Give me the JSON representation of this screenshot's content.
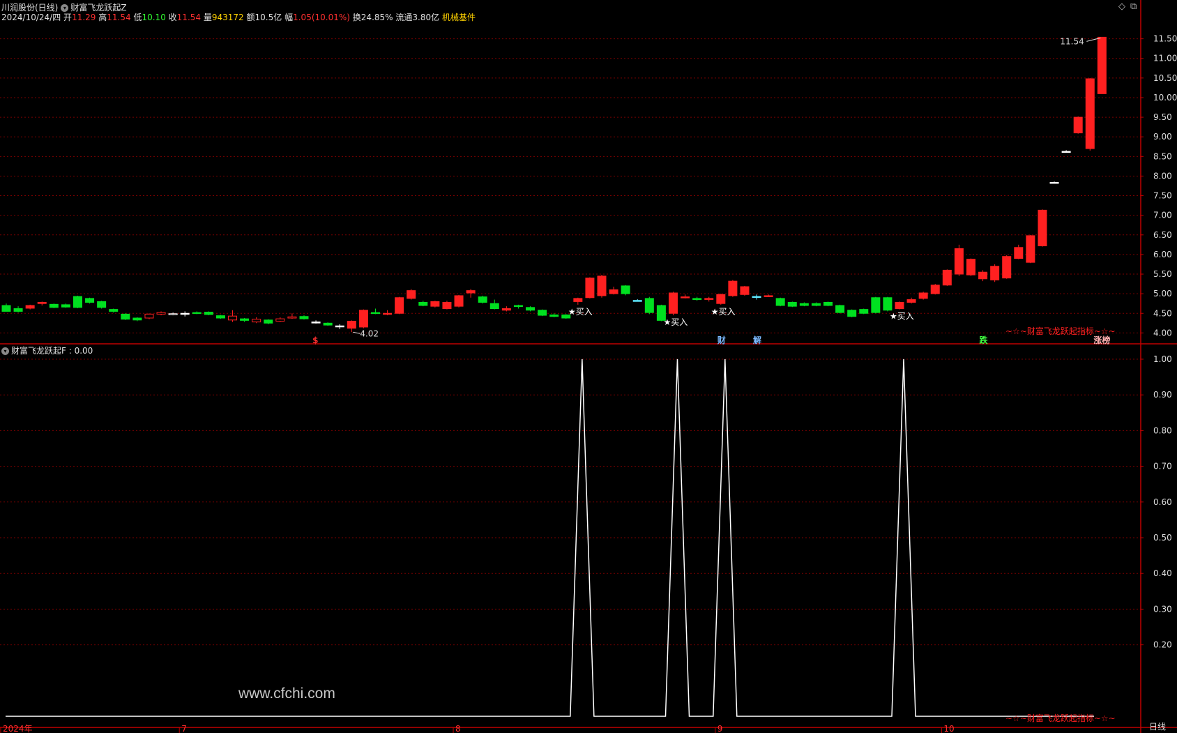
{
  "header": {
    "stock_name": "川润股份(日线)",
    "indicator_main": "财富飞龙跃起Z",
    "date": "2024/10/24/四",
    "open_label": "开",
    "open": "11.29",
    "high_label": "高",
    "high": "11.54",
    "low_label": "低",
    "low": "10.10",
    "close_label": "收",
    "close": "11.54",
    "volume_label": "量",
    "volume": "943172",
    "amount_label": "额",
    "amount": "10.5亿",
    "change_label": "幅",
    "change": "1.05(10.01%)",
    "turnover_label": "换",
    "turnover": "24.85%",
    "float_label": "流通",
    "float_cap": "3.80亿",
    "sector": "机械基件"
  },
  "sub_header": {
    "indicator": "财富飞龙跃起F",
    "value": ": 0.00"
  },
  "corner_buttons": [
    "◇",
    "⧉"
  ],
  "main_price_axis": [
    "11.50",
    "11.00",
    "10.50",
    "10.00",
    "9.50",
    "9.00",
    "8.50",
    "8.00",
    "7.50",
    "7.00",
    "6.50",
    "6.00",
    "5.50",
    "5.00",
    "4.50",
    "4.00"
  ],
  "sub_axis": [
    "1.00",
    "0.90",
    "0.80",
    "0.70",
    "0.60",
    "0.50",
    "0.40",
    "0.30",
    "0.20"
  ],
  "date_axis": [
    {
      "label": "2024年",
      "idx": 0
    },
    {
      "label": "7",
      "idx": 15
    },
    {
      "label": "8",
      "idx": 38
    },
    {
      "label": "9",
      "idx": 60
    },
    {
      "label": "10",
      "idx": 79
    }
  ],
  "period_label": "日线",
  "watermark": "www.cfchi.com",
  "main_footer": "~☆~财富飞龙跃起指标~☆~",
  "sub_footer": "~☆~财富飞龙跃起指标~☆~",
  "high_marker": "11.54",
  "low_marker": "4.02",
  "buy_label": "★买入",
  "colors": {
    "up": "#ff2020",
    "down": "#00e020",
    "doji_cyan": "#5fe8ff",
    "grid": "#7a0000",
    "axis": "#c00000",
    "line": "#ffffff",
    "yellow": "#ffd200"
  },
  "chart_data": {
    "type": "candlestick",
    "ohlc": [
      [
        4.7,
        4.55,
        4.75,
        4.55
      ],
      [
        4.62,
        4.55,
        4.68,
        4.52
      ],
      [
        4.63,
        4.7,
        4.72,
        4.6
      ],
      [
        4.75,
        4.78,
        4.8,
        4.7
      ],
      [
        4.73,
        4.65,
        4.75,
        4.63
      ],
      [
        4.72,
        4.66,
        4.75,
        4.64
      ],
      [
        4.93,
        4.65,
        4.95,
        4.63
      ],
      [
        4.88,
        4.78,
        4.9,
        4.75
      ],
      [
        4.8,
        4.65,
        4.82,
        4.62
      ],
      [
        4.6,
        4.55,
        4.62,
        4.52
      ],
      [
        4.48,
        4.35,
        4.5,
        4.33
      ],
      [
        4.38,
        4.33,
        4.4,
        4.3
      ],
      [
        4.38,
        4.48,
        4.5,
        4.35
      ],
      [
        4.48,
        4.52,
        4.55,
        4.45
      ],
      [
        4.48,
        4.49,
        4.52,
        4.45
      ],
      [
        4.5,
        4.5,
        4.55,
        4.42
      ],
      [
        4.52,
        4.5,
        4.55,
        4.48
      ],
      [
        4.53,
        4.47,
        4.55,
        4.45
      ],
      [
        4.44,
        4.38,
        4.46,
        4.36
      ],
      [
        4.33,
        4.43,
        4.58,
        4.28
      ],
      [
        4.36,
        4.32,
        4.38,
        4.28
      ],
      [
        4.28,
        4.35,
        4.4,
        4.25
      ],
      [
        4.33,
        4.25,
        4.35,
        4.22
      ],
      [
        4.3,
        4.36,
        4.4,
        4.28
      ],
      [
        4.38,
        4.41,
        4.5,
        4.36
      ],
      [
        4.42,
        4.36,
        4.45,
        4.34
      ],
      [
        4.28,
        4.28,
        4.32,
        4.24
      ],
      [
        4.25,
        4.2,
        4.27,
        4.18
      ],
      [
        4.18,
        4.17,
        4.22,
        4.1
      ],
      [
        4.12,
        4.3,
        4.32,
        4.02
      ],
      [
        4.15,
        4.58,
        4.6,
        4.12
      ],
      [
        4.52,
        4.5,
        4.62,
        4.48
      ],
      [
        4.48,
        4.5,
        4.58,
        4.45
      ],
      [
        4.5,
        4.9,
        4.92,
        4.48
      ],
      [
        4.88,
        5.08,
        5.12,
        4.85
      ],
      [
        4.78,
        4.7,
        4.82,
        4.68
      ],
      [
        4.68,
        4.8,
        4.82,
        4.65
      ],
      [
        4.62,
        4.78,
        4.82,
        4.6
      ],
      [
        4.68,
        4.95,
        4.97,
        4.65
      ],
      [
        5.02,
        5.08,
        5.12,
        4.9
      ],
      [
        4.92,
        4.78,
        4.95,
        4.75
      ],
      [
        4.75,
        4.62,
        4.85,
        4.6
      ],
      [
        4.58,
        4.62,
        4.68,
        4.55
      ],
      [
        4.7,
        4.68,
        4.72,
        4.62
      ],
      [
        4.65,
        4.58,
        4.68,
        4.55
      ],
      [
        4.58,
        4.45,
        4.6,
        4.43
      ],
      [
        4.46,
        4.42,
        4.5,
        4.4
      ],
      [
        4.46,
        4.38,
        4.48,
        4.36
      ],
      [
        4.8,
        4.88,
        4.9,
        4.72
      ],
      [
        4.9,
        5.4,
        5.42,
        4.88
      ],
      [
        4.95,
        5.45,
        5.48,
        4.9
      ],
      [
        5.0,
        5.1,
        5.18,
        4.98
      ],
      [
        5.2,
        5.0,
        5.22,
        4.96
      ],
      [
        4.83,
        4.83,
        4.86,
        4.8
      ],
      [
        4.88,
        4.52,
        4.92,
        4.48
      ],
      [
        4.7,
        4.32,
        4.72,
        4.3
      ],
      [
        4.5,
        5.02,
        5.05,
        4.45
      ],
      [
        4.9,
        4.92,
        4.98,
        4.88
      ],
      [
        4.88,
        4.85,
        4.92,
        4.82
      ],
      [
        4.86,
        4.88,
        4.92,
        4.8
      ],
      [
        4.75,
        4.98,
        5.0,
        4.72
      ],
      [
        4.95,
        5.32,
        5.35,
        4.92
      ],
      [
        4.98,
        5.18,
        5.2,
        4.95
      ],
      [
        4.93,
        4.93,
        4.98,
        4.85
      ],
      [
        4.93,
        4.95,
        4.98,
        4.92
      ],
      [
        4.88,
        4.7,
        4.9,
        4.68
      ],
      [
        4.78,
        4.68,
        4.8,
        4.66
      ],
      [
        4.75,
        4.7,
        4.78,
        4.68
      ],
      [
        4.75,
        4.7,
        4.78,
        4.68
      ],
      [
        4.78,
        4.7,
        4.8,
        4.68
      ],
      [
        4.7,
        4.52,
        4.72,
        4.5
      ],
      [
        4.58,
        4.42,
        4.6,
        4.4
      ],
      [
        4.6,
        4.5,
        4.62,
        4.48
      ],
      [
        4.9,
        4.52,
        4.92,
        4.5
      ],
      [
        4.9,
        4.58,
        4.92,
        4.55
      ],
      [
        4.62,
        4.78,
        4.8,
        4.6
      ],
      [
        4.78,
        4.85,
        4.9,
        4.75
      ],
      [
        4.88,
        5.02,
        5.05,
        4.85
      ],
      [
        5.0,
        5.22,
        5.25,
        4.98
      ],
      [
        5.22,
        5.6,
        5.62,
        5.2
      ],
      [
        5.5,
        6.15,
        6.25,
        5.45
      ],
      [
        5.48,
        5.88,
        5.9,
        5.45
      ],
      [
        5.38,
        5.55,
        5.6,
        5.32
      ],
      [
        5.35,
        5.7,
        5.75,
        5.3
      ],
      [
        5.4,
        5.95,
        5.98,
        5.38
      ],
      [
        5.9,
        6.18,
        6.25,
        5.88
      ],
      [
        5.8,
        6.48,
        6.5,
        5.78
      ],
      [
        6.22,
        7.13,
        7.15,
        6.2
      ],
      [
        7.84,
        7.84,
        7.86,
        7.82
      ],
      [
        8.63,
        8.63,
        8.66,
        8.6
      ],
      [
        9.1,
        9.5,
        9.52,
        9.08
      ],
      [
        8.7,
        10.48,
        10.5,
        8.65
      ],
      [
        10.1,
        11.54,
        11.54,
        10.1
      ]
    ],
    "markers": [
      {
        "idx": 29,
        "type": "low",
        "label": "4.02"
      },
      {
        "idx": 92,
        "type": "high",
        "label": "11.54"
      },
      {
        "idx": 48,
        "type": "buy"
      },
      {
        "idx": 56,
        "type": "buy"
      },
      {
        "idx": 60,
        "type": "buy"
      },
      {
        "idx": 75,
        "type": "buy"
      }
    ],
    "events": [
      {
        "idx": 26,
        "label": "$",
        "color": "#ff3030"
      },
      {
        "idx": 60,
        "label": "财",
        "color": "#7ab8ff"
      },
      {
        "idx": 63,
        "label": "解",
        "color": "#7ab8ff"
      },
      {
        "idx": 82,
        "label": "跌",
        "color": "#40ff40"
      },
      {
        "idx": 92,
        "label": "涨榜",
        "color": "#ffb0b0"
      }
    ],
    "y_range": [
      3.9,
      11.6
    ],
    "sub_signal_idx": [
      48,
      56,
      60,
      75
    ],
    "sub_y_range": [
      0,
      1.05
    ]
  }
}
